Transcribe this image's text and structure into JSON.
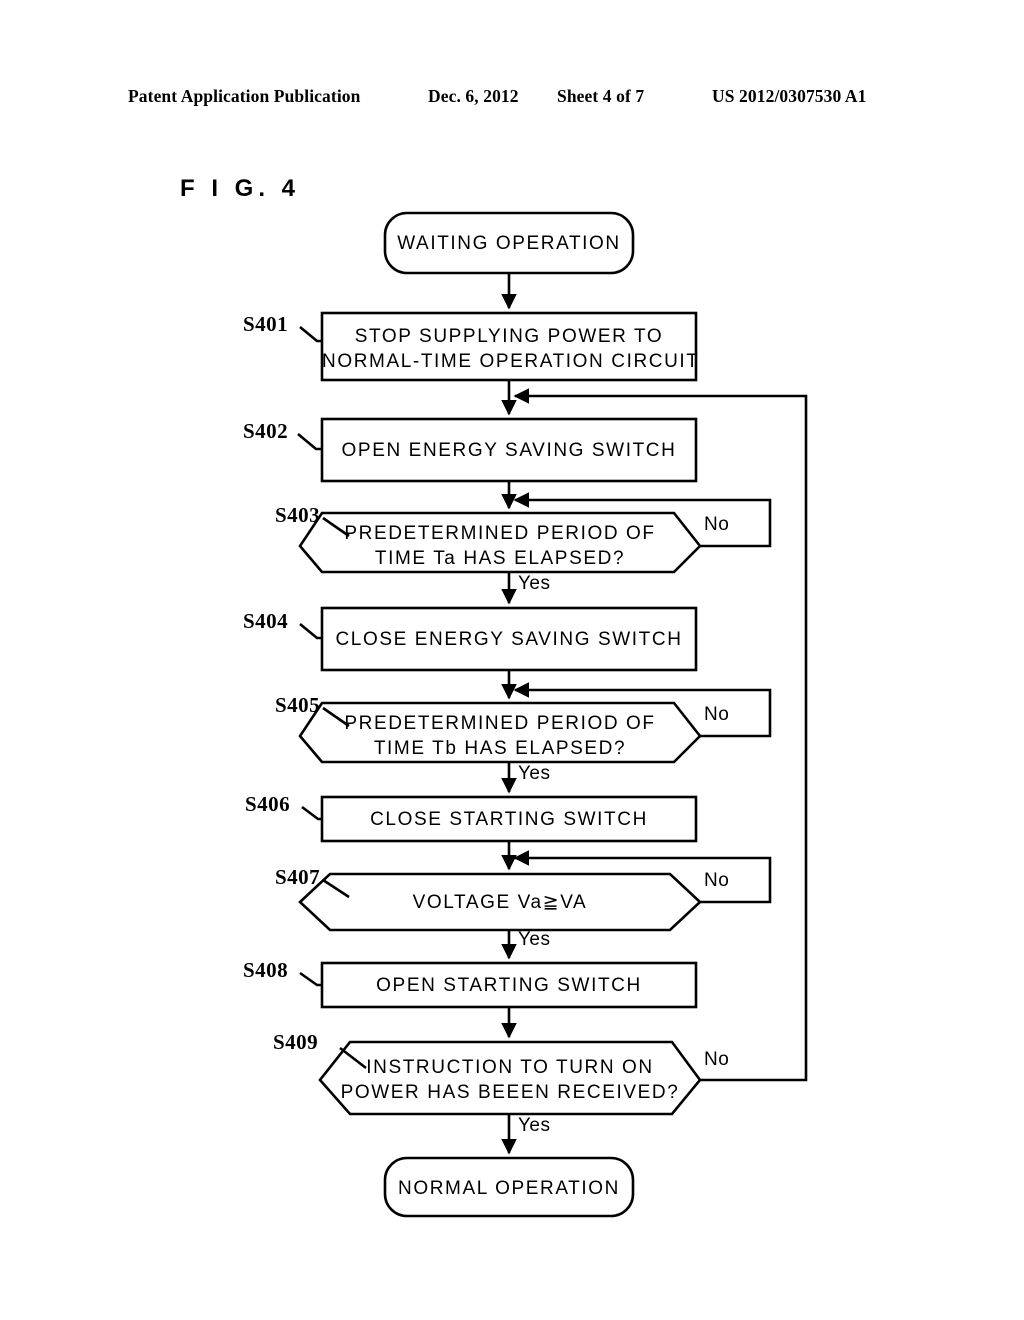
{
  "header": {
    "publication": "Patent Application Publication",
    "date": "Dec. 6, 2012",
    "sheet": "Sheet 4 of 7",
    "doc_id": "US 2012/0307530 A1"
  },
  "figure": {
    "caption": "F I G.  4"
  },
  "flowchart": {
    "type": "flowchart",
    "start_terminal": {
      "id": "start",
      "shape": "rounded-rectangle",
      "label": "WAITING OPERATION"
    },
    "end_terminal": {
      "id": "end",
      "shape": "rounded-rectangle",
      "label": "NORMAL OPERATION"
    },
    "steps": [
      {
        "id": "S401",
        "step_label": "S401",
        "shape": "rectangle",
        "line1": "STOP SUPPLYING POWER TO",
        "line2": "NORMAL-TIME OPERATION CIRCUIT"
      },
      {
        "id": "S402",
        "step_label": "S402",
        "shape": "rectangle",
        "line1": "OPEN ENERGY SAVING SWITCH",
        "line2": ""
      },
      {
        "id": "S403",
        "step_label": "S403",
        "shape": "hexagon",
        "line1": "PREDETERMINED PERIOD OF",
        "line2": "TIME Ta HAS ELAPSED?",
        "yes_label": "Yes",
        "no_label": "No"
      },
      {
        "id": "S404",
        "step_label": "S404",
        "shape": "rectangle",
        "line1": "CLOSE ENERGY SAVING SWITCH",
        "line2": ""
      },
      {
        "id": "S405",
        "step_label": "S405",
        "shape": "hexagon",
        "line1": "PREDETERMINED PERIOD OF",
        "line2": "TIME Tb HAS ELAPSED?",
        "yes_label": "Yes",
        "no_label": "No"
      },
      {
        "id": "S406",
        "step_label": "S406",
        "shape": "rectangle",
        "line1": "CLOSE STARTING SWITCH",
        "line2": ""
      },
      {
        "id": "S407",
        "step_label": "S407",
        "shape": "hexagon",
        "line1": "VOLTAGE Va≧VA",
        "line2": "",
        "yes_label": "Yes",
        "no_label": "No"
      },
      {
        "id": "S408",
        "step_label": "S408",
        "shape": "rectangle",
        "line1": "OPEN STARTING SWITCH",
        "line2": ""
      },
      {
        "id": "S409",
        "step_label": "S409",
        "shape": "hexagon",
        "line1": "INSTRUCTION TO TURN ON",
        "line2": "POWER HAS BEEEN RECEIVED?",
        "yes_label": "Yes",
        "no_label": "No"
      }
    ],
    "colors": {
      "stroke": "#000000",
      "fill": "#ffffff",
      "text": "#000000"
    }
  }
}
